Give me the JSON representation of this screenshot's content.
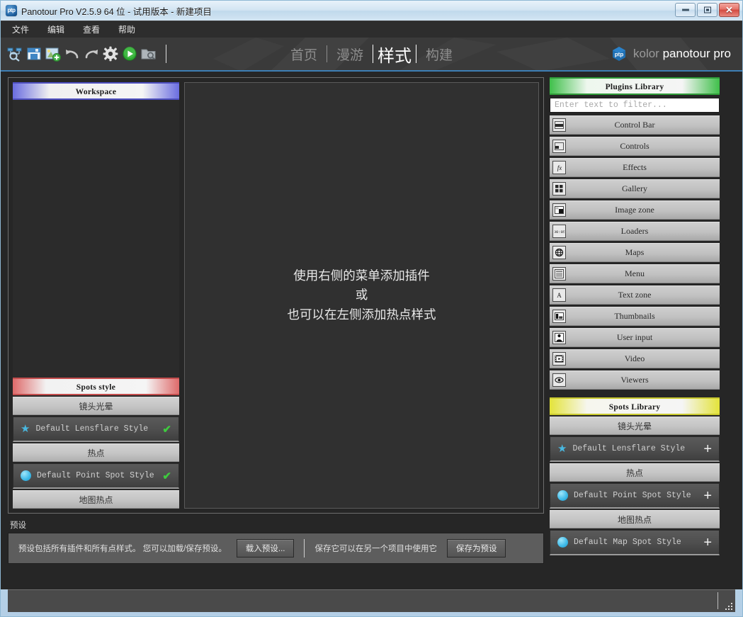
{
  "window": {
    "title": "Panotour Pro V2.5.9 64 位 - 试用版本 - 新建项目",
    "icon": "ptp",
    "controls": {
      "minimize": "minimize-icon",
      "maximize": "maximize-icon",
      "close": "✕"
    }
  },
  "menubar": {
    "items": [
      "文件",
      "编辑",
      "查看",
      "帮助"
    ]
  },
  "toolbar": {
    "icons": [
      "open-project-icon",
      "save-icon",
      "add-panorama-icon",
      "undo-icon",
      "redo-icon",
      "settings-icon",
      "play-icon",
      "browse-output-icon"
    ]
  },
  "nav": {
    "tabs": [
      {
        "label": "首页",
        "active": false
      },
      {
        "label": "漫游",
        "active": false
      },
      {
        "label": "样式",
        "active": true
      },
      {
        "label": "构建",
        "active": false
      }
    ]
  },
  "brand": {
    "logo": "ptp-logo-icon",
    "kolor": "kolor",
    "product": "panotour pro"
  },
  "workspace": {
    "header": "Workspace",
    "spots_style_header": "Spots style",
    "groups": [
      {
        "title": "镜头光晕",
        "rows": [
          {
            "icon": "star-icon",
            "label": "Default Lensflare Style",
            "action": "✔"
          }
        ]
      },
      {
        "title": "热点",
        "rows": [
          {
            "icon": "circle-icon",
            "label": "Default Point Spot Style",
            "action": "✔"
          }
        ]
      },
      {
        "title": "地图热点",
        "rows": []
      }
    ]
  },
  "viewport": {
    "lines": [
      "使用右侧的菜单添加插件",
      "或",
      "也可以在左侧添加热点样式"
    ]
  },
  "preset": {
    "title": "预设",
    "description": "预设包括所有插件和所有点样式。 您可以加载/保存预设。",
    "load_button": "载入预设...",
    "save_description": "保存它可以在另一个项目中使用它",
    "save_button": "保存为预设"
  },
  "plugins_library": {
    "header": "Plugins Library",
    "filter_placeholder": "Enter text to filter...",
    "filter_value": "",
    "items": [
      {
        "label": "Control Bar",
        "icon": "control-bar-icon"
      },
      {
        "label": "Controls",
        "icon": "controls-icon"
      },
      {
        "label": "Effects",
        "icon": "effects-fx-icon"
      },
      {
        "label": "Gallery",
        "icon": "gallery-grid-icon"
      },
      {
        "label": "Image zone",
        "icon": "image-zone-icon"
      },
      {
        "label": "Loaders",
        "icon": "loaders-icon"
      },
      {
        "label": "Maps",
        "icon": "globe-icon"
      },
      {
        "label": "Menu",
        "icon": "menu-lines-icon"
      },
      {
        "label": "Text zone",
        "icon": "text-a-icon"
      },
      {
        "label": "Thumbnails",
        "icon": "thumbnails-icon"
      },
      {
        "label": "User input",
        "icon": "user-input-icon"
      },
      {
        "label": "Video",
        "icon": "video-film-icon"
      },
      {
        "label": "Viewers",
        "icon": "eye-icon"
      }
    ]
  },
  "spots_library": {
    "header": "Spots Library",
    "groups": [
      {
        "title": "镜头光晕",
        "rows": [
          {
            "icon": "star-icon",
            "label": "Default Lensflare Style",
            "action": "+"
          }
        ]
      },
      {
        "title": "热点",
        "rows": [
          {
            "icon": "circle-icon",
            "label": "Default Point Spot Style",
            "action": "+"
          }
        ]
      },
      {
        "title": "地图热点",
        "rows": [
          {
            "icon": "circle-icon",
            "label": "Default Map Spot Style",
            "action": "+"
          }
        ]
      }
    ]
  },
  "colors": {
    "accent_blue": "#3d7fb5",
    "workspace_header": "#6a6de0",
    "spots_style_header": "#de6a6a",
    "plugins_header": "#3fbf4a",
    "spots_library_header": "#e3e33a",
    "check_green": "#3ecb3e",
    "spot_cyan": "#3cb9e8"
  }
}
